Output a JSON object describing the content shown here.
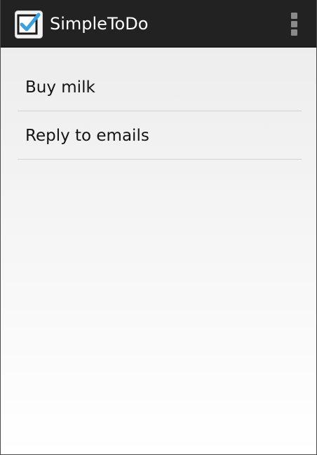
{
  "app": {
    "title": "SimpleToDo",
    "icon": "checkbox-checked-icon",
    "accent_color": "#3aa0e0"
  },
  "action_bar": {
    "overflow_icon": "more-vertical-icon",
    "background_color": "#222222"
  },
  "todos": [
    {
      "text": "Buy milk"
    },
    {
      "text": "Reply to emails"
    }
  ]
}
